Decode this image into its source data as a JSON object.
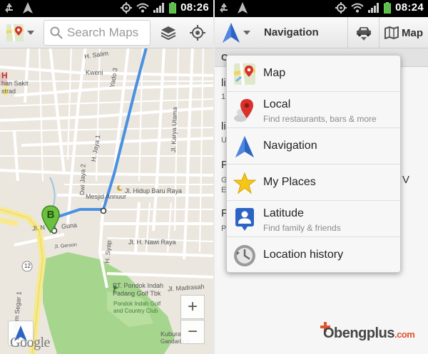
{
  "left": {
    "status": {
      "time": "08:26"
    },
    "search": {
      "placeholder": "Search Maps"
    },
    "map": {
      "labels": {
        "salim": "H. Salim",
        "kweni": "Kweni",
        "yado": "Yado 3",
        "h": "H",
        "sakit": "han Sakit",
        "strad": "strad",
        "karya": "Jl. Karya Utama",
        "dwi": "Dwi Jaya 2",
        "hidup": "Jl. Hidup Baru Raya",
        "jaya1": "H. Jaya 1",
        "mesjid": "Mesjid Annuur",
        "guna": "Jl. N",
        "guna2": "Guna",
        "nawi": "Jl. H. Nawi Raya",
        "syap": "H. Syap",
        "madrasah": "Jl. Madrasah",
        "pondok1": "PT. Pondok Indah",
        "pondok2": "Padang Golf Tbk",
        "golf1": "Pondok Indah Golf",
        "golf2": "and Country Club",
        "alam": "Jl. Alam Segar 1",
        "kubura": "Kubura",
        "gandaria": "Gandaria U",
        "gersim": "Jl. Gerson",
        "road12": "12",
        "h2": "Jl."
      },
      "marker": "B",
      "zoom_in": "+",
      "zoom_out": "−",
      "logo": "Google"
    }
  },
  "right": {
    "status": {
      "time": "08:24"
    },
    "toolbar": {
      "title": "Navigation",
      "map_button": "Map"
    },
    "behind": {
      "header": "C",
      "rows": [
        "li",
        "1",
        "li",
        "U",
        "P",
        "G",
        "E",
        "P",
        "P",
        "V"
      ]
    },
    "menu": [
      {
        "label": "Map",
        "sub": "",
        "icon": "maps-app-icon"
      },
      {
        "label": "Local",
        "sub": "Find restaurants, bars & more",
        "icon": "local-pin-icon"
      },
      {
        "label": "Navigation",
        "sub": "",
        "icon": "navigation-arrow-icon"
      },
      {
        "label": "My Places",
        "sub": "",
        "icon": "star-icon"
      },
      {
        "label": "Latitude",
        "sub": "Find family & friends",
        "icon": "latitude-icon"
      },
      {
        "label": "Location history",
        "sub": "",
        "icon": "history-icon"
      }
    ]
  },
  "watermark": {
    "brand": "Obengplus",
    "tld": ".com"
  },
  "colors": {
    "route": "#4a90e2",
    "road_yellow": "#f7e98e",
    "park": "#a6d68d",
    "accent_blue": "#2c64c4"
  }
}
